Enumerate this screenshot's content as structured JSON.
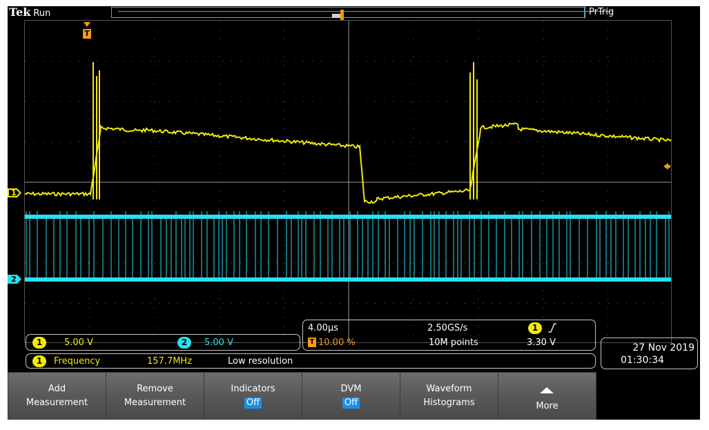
{
  "header": {
    "brand": "Tek",
    "state": "Run",
    "trigger_status": "PrTrig"
  },
  "channels": [
    {
      "number": "1",
      "label": "1",
      "color": "#f2ea0a",
      "scale": "5.00 V"
    },
    {
      "number": "2",
      "label": "2",
      "color": "#29e0ef",
      "scale": "5.00 V"
    }
  ],
  "horizontal": {
    "time_per_div": "4.00µs",
    "sample_rate": "2.50GS/s",
    "trigger_position": "10.00 %",
    "record_length": "10M points"
  },
  "trigger": {
    "marker_label": "T",
    "source": "1",
    "slope_icon": "rising-edge-icon",
    "level": "3.30 V",
    "color": "#f49a1a"
  },
  "measurement": {
    "source": "1",
    "name": "Frequency",
    "value": "157.7MHz",
    "note": "Low resolution"
  },
  "clock": {
    "date": "27 Nov 2019",
    "time": "01:30:34"
  },
  "softkeys": [
    {
      "line1": "Add",
      "line2": "Measurement"
    },
    {
      "line1": "Remove",
      "line2": "Measurement"
    },
    {
      "line1": "Indicators",
      "line2": "Off"
    },
    {
      "line1": "DVM",
      "line2": "Off"
    },
    {
      "line1": "Waveform",
      "line2": "Histograms"
    },
    {
      "line1": "",
      "line2": "More",
      "icon": "up-arrow-icon"
    }
  ]
}
